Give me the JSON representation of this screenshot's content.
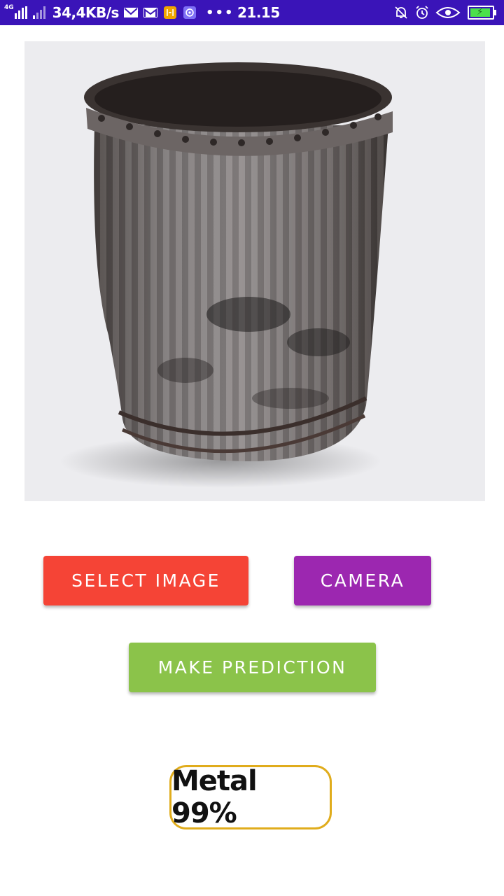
{
  "status_bar": {
    "network_type": "4G",
    "speed": "34,4KB/s",
    "dots": "•••",
    "time": "21.15",
    "icons": [
      "signal-icon",
      "signal-icon",
      "mail-icon",
      "gmail-icon",
      "app-icon",
      "vpn-icon",
      "mute-bell-icon",
      "alarm-icon",
      "eye-icon",
      "battery-charging-icon"
    ]
  },
  "image": {
    "description_icon": "trash-can-image"
  },
  "buttons": {
    "select_image": "SELECT IMAGE",
    "camera": "CAMERA",
    "make_prediction": "MAKE PREDICTION"
  },
  "result": {
    "text": "Metal 99%"
  },
  "colors": {
    "status_bar": "#3a14b8",
    "select_image": "#f54436",
    "camera": "#9c27b0",
    "make_prediction": "#8bc34a",
    "result_border": "#e0ac1c"
  }
}
